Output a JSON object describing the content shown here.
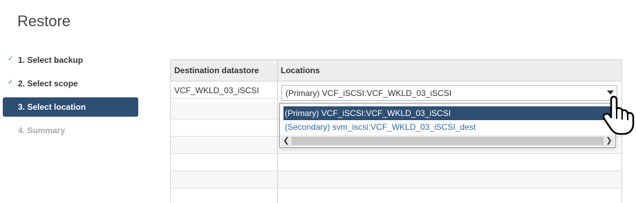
{
  "page": {
    "title": "Restore"
  },
  "steps": [
    {
      "label": "1. Select backup",
      "state": "completed",
      "icon": "check-icon"
    },
    {
      "label": "2. Select scope",
      "state": "completed",
      "icon": "check-icon"
    },
    {
      "label": "3. Select location",
      "state": "active"
    },
    {
      "label": "4. Summary",
      "state": "disabled"
    }
  ],
  "grid": {
    "columns": [
      "Destination datastore",
      "Locations"
    ],
    "rows": [
      {
        "datastore": "VCF_WKLD_03_iSCSI",
        "location": "(Primary) VCF_iSCSI:VCF_WKLD_03_iSCSI"
      }
    ]
  },
  "location_select": {
    "value": "(Primary) VCF_iSCSI:VCF_WKLD_03_iSCSI",
    "options": [
      "(Primary) VCF_iSCSI:VCF_WKLD_03_iSCSI",
      "(Secondary) svm_iscsi:VCF_WKLD_03_iSCSI_dest"
    ]
  },
  "colors": {
    "active_step": "#2e4e72",
    "check": "#2f9e44",
    "option_link": "#2e6aa8"
  }
}
